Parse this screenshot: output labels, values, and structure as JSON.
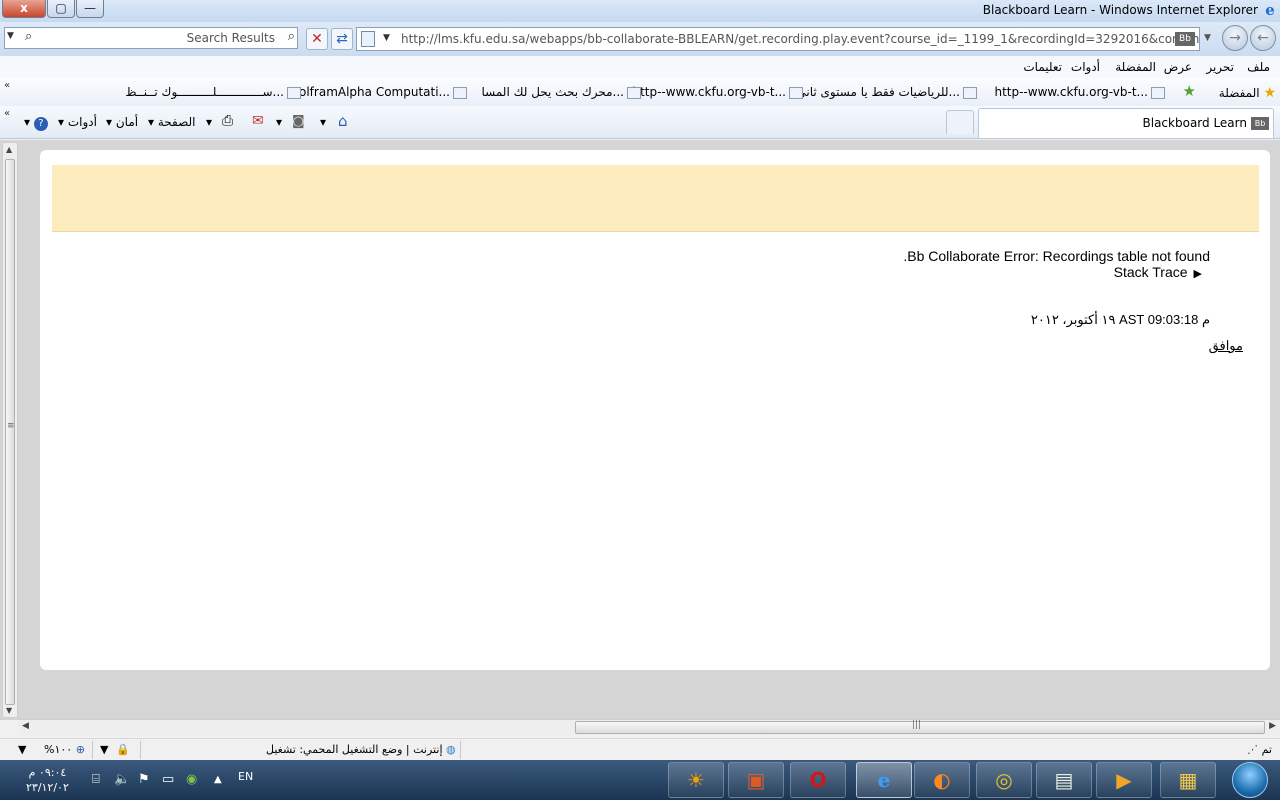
{
  "window": {
    "title": "Blackboard Learn - Windows Internet Explorer",
    "close_label": "x",
    "max_label": "▢",
    "min_label": "—"
  },
  "search": {
    "placeholder": "Search Results"
  },
  "address": {
    "url": "http://lms.kfu.edu.sa/webapps/bb-collaborate-BBLEARN/get.recording.play.event?course_id=_1199_1&recordingId=3292016&contentType=recor",
    "badge": "Bb"
  },
  "menu": {
    "items": [
      "ملف",
      "تحرير",
      "عرض",
      "المفضلة",
      "أدوات",
      "تعليمات"
    ]
  },
  "favorites": {
    "label": "المفضلة",
    "items": [
      "http--www.ckfu.org-vb-t...",
      "للرياضيات فقط يا مستوى ثاني...",
      "http--www.ckfu.org-vb-t...",
      "محرك بحث يحل لك المسا...",
      "WolframAlpha Computati...",
      "ســـــــــــــلــــــــــوك تــنــظ..."
    ]
  },
  "commandbar": {
    "page": "الصفحة",
    "safety": "أمان",
    "tools": "أدوات"
  },
  "tab": {
    "label": "Blackboard Learn",
    "badge": "Bb"
  },
  "content": {
    "error": ".Bb Collaborate Error: Recordings table not found",
    "stack_trace": "Stack Trace",
    "timestamp": "١٩ أكتوبر، ٢٠١٢ AST 09:03:18 م",
    "ok": "موافق"
  },
  "status": {
    "done": "تم",
    "zone": "إنترنت | وضع التشغيل المحمي: تشغيل",
    "zoom": "%١٠٠"
  },
  "taskbar": {
    "time": "٠٩:٠٤ م",
    "date": "٢٣/١٢/٠٢",
    "lang": "EN"
  }
}
